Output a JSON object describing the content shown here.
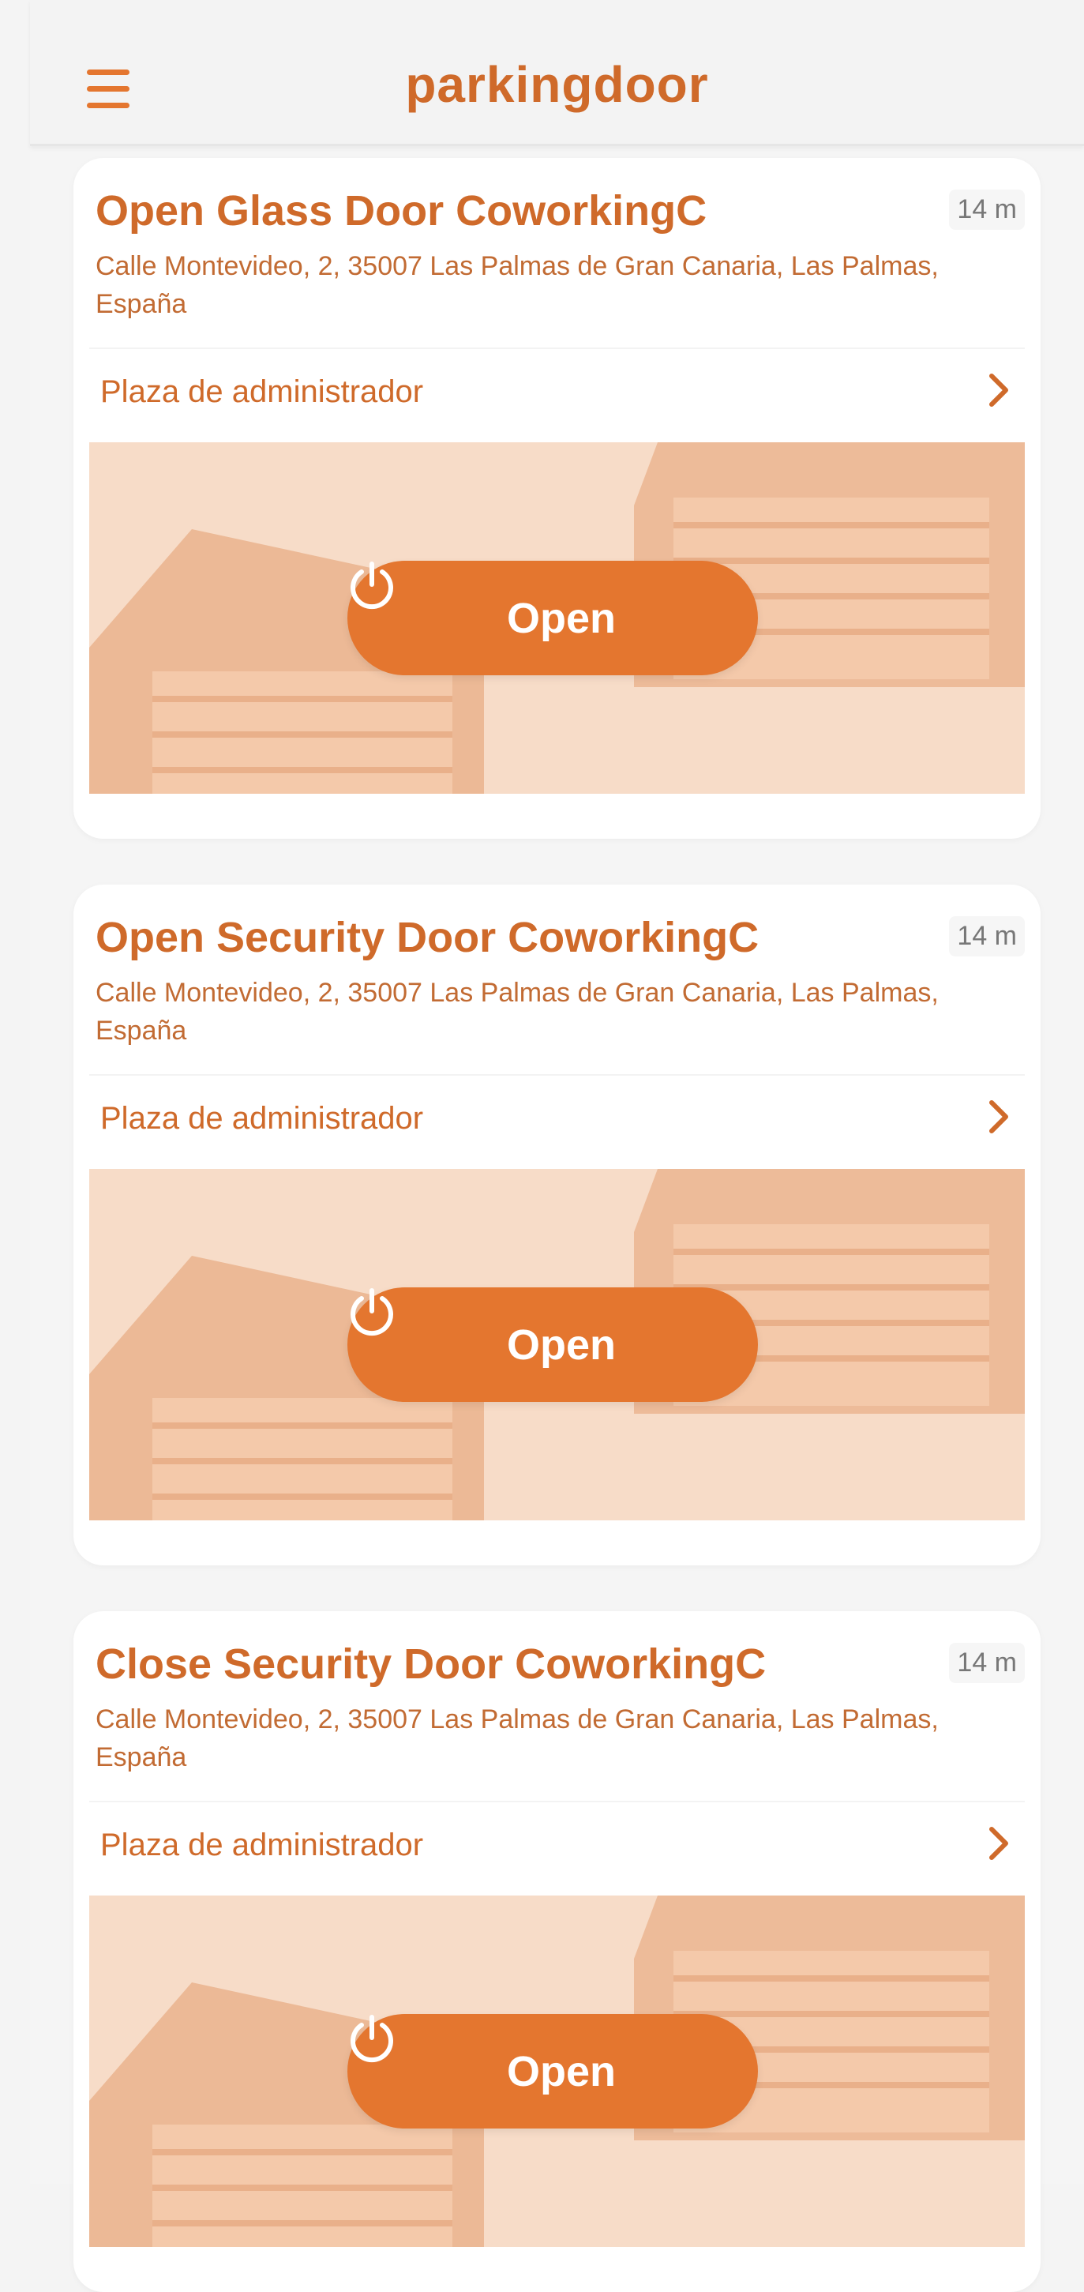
{
  "app": {
    "brand": "parkingdoor",
    "colors": {
      "accent": "#e4762f",
      "accent_light": "#e9b08a",
      "door_bg": "#f7dcc8",
      "text_accent": "#cf6a2a"
    }
  },
  "header": {
    "menu_icon": "hamburger-menu-icon"
  },
  "doors": [
    {
      "title": "Open Glass Door  CoworkingC",
      "distance": "14 m",
      "address": "Calle Montevideo, 2, 35007 Las Palmas de Gran Canaria, Las Palmas, España",
      "spot_label": "Plaza de administrador",
      "button_label": "Open",
      "button_icon": "power-icon"
    },
    {
      "title": "Open Security Door CoworkingC",
      "distance": "14 m",
      "address": "Calle Montevideo, 2, 35007 Las Palmas de Gran Canaria, Las Palmas, España",
      "spot_label": "Plaza de administrador",
      "button_label": "Open",
      "button_icon": "power-icon"
    },
    {
      "title": "Close Security Door CoworkingC",
      "distance": "14 m",
      "address": "Calle Montevideo, 2, 35007 Las Palmas de Gran Canaria, Las Palmas, España",
      "spot_label": "Plaza de administrador",
      "button_label": "Open",
      "button_icon": "power-icon"
    }
  ]
}
